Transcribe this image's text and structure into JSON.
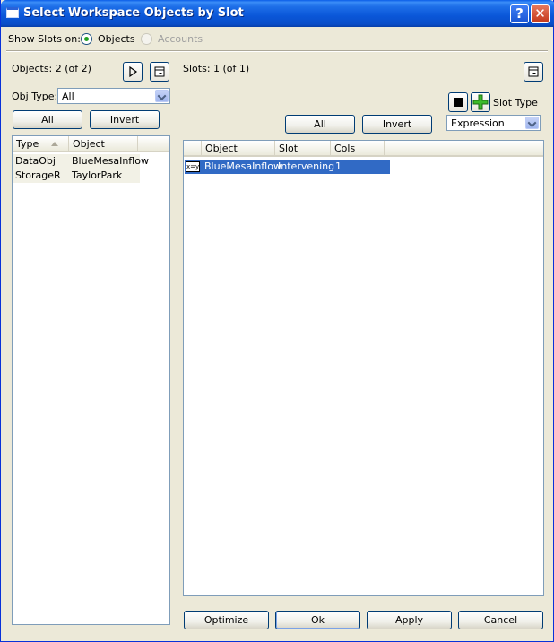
{
  "window": {
    "title": "Select Workspace Objects by Slot"
  },
  "show_slots": {
    "label": "Show Slots on:",
    "options": [
      {
        "label": "Objects",
        "checked": true,
        "enabled": true
      },
      {
        "label": "Accounts",
        "checked": false,
        "enabled": false
      }
    ]
  },
  "objects_panel": {
    "count_label": "Objects: 2 (of 2)",
    "obj_type_label": "Obj Type:",
    "obj_type_value": "All",
    "all_button": "All",
    "invert_button": "Invert",
    "columns": [
      "Type",
      "Object"
    ],
    "rows": [
      [
        "DataObj",
        "BlueMesaInflow"
      ],
      [
        "StorageR",
        "TaylorPark"
      ]
    ]
  },
  "slots_panel": {
    "count_label": "Slots: 1 (of 1)",
    "slot_type_label": "Slot Type",
    "slot_type_value": "Expression",
    "all_button": "All",
    "invert_button": "Invert",
    "columns": [
      "Object",
      "Slot",
      "Cols"
    ],
    "rows": [
      {
        "icon": "x=y",
        "object": "BlueMesaInflow",
        "slot": "Intervening",
        "cols": "1"
      }
    ]
  },
  "footer": {
    "optimize": "Optimize",
    "ok": "Ok",
    "apply": "Apply",
    "cancel": "Cancel"
  },
  "colors": {
    "title_bar": "#0a56d8",
    "selection": "#316ac5",
    "face": "#ece9d8"
  }
}
